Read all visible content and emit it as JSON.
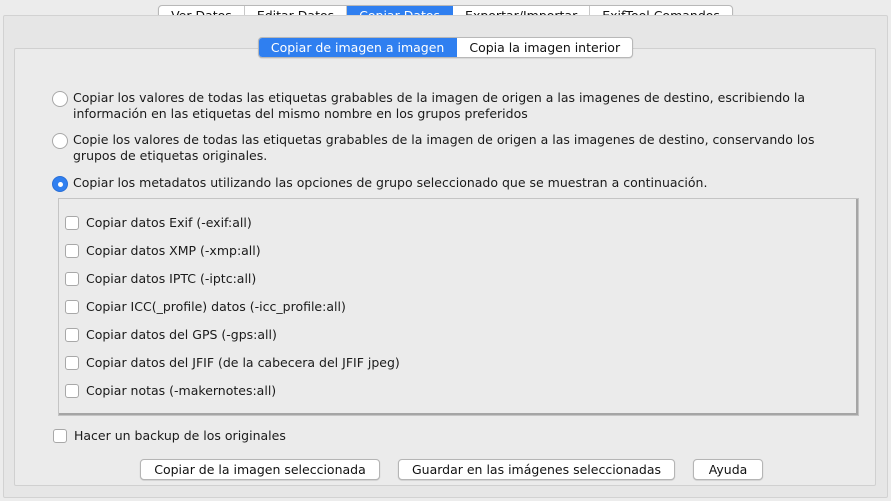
{
  "main_tabs": [
    "Ver Datos",
    "Editar Datos",
    "Copiar Datos",
    "Exportar/Importar",
    "ExifTool Comandos"
  ],
  "sub_tabs": [
    "Copiar de imagen a imagen",
    "Copia la imagen interior"
  ],
  "radio_options": [
    "Copiar los valores de todas las etiquetas grabables de la imagen de origen a las imagenes de destino, escribiendo la información en las etiquetas del mismo nombre en los grupos preferidos",
    "Copie los valores de todas las etiquetas grabables de la imagen de origen a las imagenes de destino, conservando los grupos de etiquetas originales.",
    "Copiar los metadatos utilizando las opciones de grupo seleccionado que se muestran a continuación."
  ],
  "group_checkboxes": [
    "Copiar datos Exif (-exif:all)",
    "Copiar datos XMP (-xmp:all)",
    "Copiar datos IPTC (-iptc:all)",
    "Copiar ICC(_profile) datos (-icc_profile:all)",
    "Copiar datos del GPS (-gps:all)",
    "Copiar datos del JFIF (de la cabecera del JFIF jpeg)",
    "Copiar notas (-makernotes:all)"
  ],
  "backup_label": "Hacer un backup de los originales",
  "buttons": {
    "copy_from_selected": "Copiar de la imagen seleccionada",
    "save_to_selected": "Guardar en las imágenes seleccionadas",
    "help": "Ayuda"
  },
  "colors": {
    "accent": "#2f7ff0"
  }
}
